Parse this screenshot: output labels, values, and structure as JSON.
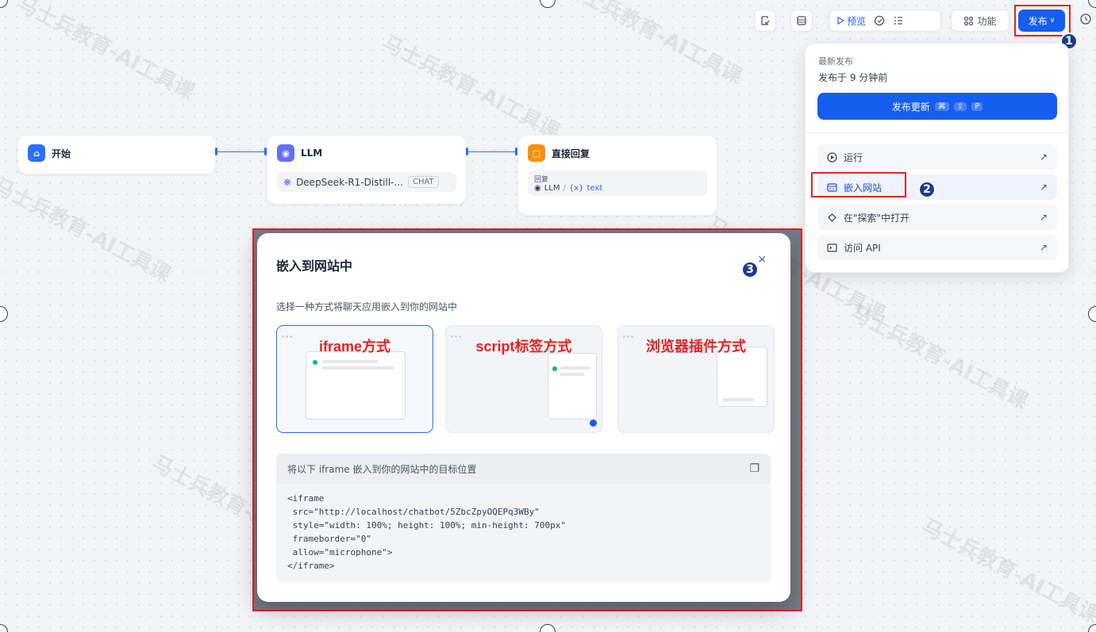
{
  "toolbar": {
    "preview_label": "预览",
    "features_label": "功能",
    "publish_label": "发布"
  },
  "workflow": {
    "start": {
      "title": "开始"
    },
    "llm": {
      "title": "LLM",
      "model": "DeepSeek-R1-Distill-...",
      "mode": "CHAT"
    },
    "reply": {
      "title": "直接回复",
      "field_label": "回复",
      "var_node": "LLM",
      "var_name": "text",
      "var_prefix": "{x}"
    }
  },
  "publish_menu": {
    "latest_label": "最新发布",
    "published_time": "发布于 9 分钟前",
    "update_button": "发布更新",
    "update_shortcut": [
      "⌘",
      "⇧",
      "P"
    ],
    "items": [
      {
        "label": "运行",
        "icon": "play-circle-icon"
      },
      {
        "label": "嵌入网站",
        "icon": "embed-icon"
      },
      {
        "label": "在\"探索\"中打开",
        "icon": "explore-icon"
      },
      {
        "label": "访问 API",
        "icon": "terminal-icon"
      }
    ]
  },
  "embed_modal": {
    "title": "嵌入到网站中",
    "description": "选择一种方式将聊天应用嵌入到你的网站中",
    "options": [
      {
        "label": "iframe方式",
        "selected": true
      },
      {
        "label": "script标签方式",
        "selected": false
      },
      {
        "label": "浏览器插件方式",
        "selected": false
      }
    ],
    "code_title": "将以下 iframe 嵌入到你的网站中的目标位置",
    "code": "<iframe\n src=\"http://localhost/chatbot/5ZbcZpyOQEPq3WBy\"\n style=\"width: 100%; height: 100%; min-height: 700px\"\n frameborder=\"0\"\n allow=\"microphone\">\n</iframe>"
  },
  "annotations": [
    "1",
    "2",
    "3"
  ],
  "watermark": "马士兵教育-AI工具课",
  "colors": {
    "primary": "#155eef",
    "highlight": "#e02424",
    "badge": "#1e3a8a"
  }
}
